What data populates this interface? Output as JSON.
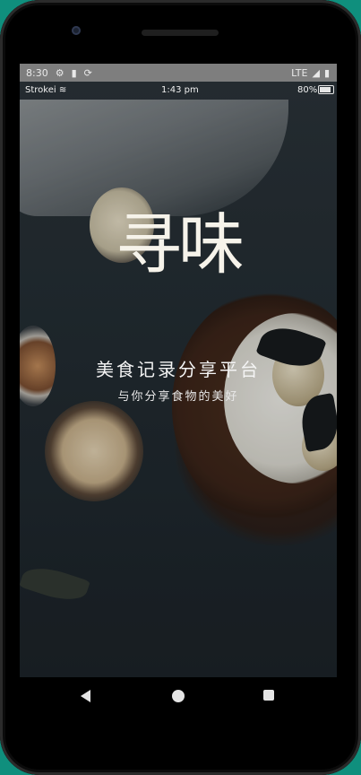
{
  "system_status_bar": {
    "time": "8:30",
    "network": "LTE"
  },
  "sim_status_bar": {
    "carrier": "Strokei",
    "time": "1:43 pm",
    "battery": "80%"
  },
  "splash": {
    "logo_text": "寻味",
    "tagline": "美食记录分享平台",
    "subline": "与你分享食物的美好"
  },
  "icons": {
    "settings": "gear-icon",
    "sim": "sim-card-icon",
    "sync": "sync-icon",
    "signal": "signal-icon",
    "battery": "battery-icon",
    "wifi": "wifi-icon"
  },
  "colors": {
    "status_bar": "#7e7e7e",
    "text_light": "#f4f4f4",
    "frame": "#000000",
    "page_bg": "#0f8f7d"
  }
}
